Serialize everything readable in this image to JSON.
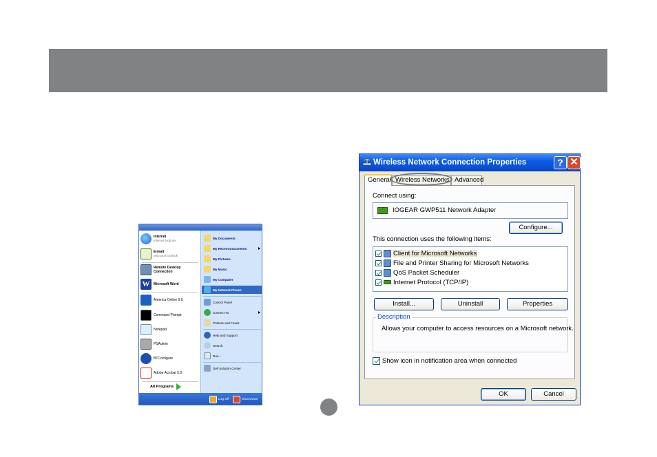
{
  "start_menu": {
    "pinned": [
      {
        "title": "Internet",
        "subtitle": "Internet Explorer",
        "icon": "internet-explorer-icon"
      },
      {
        "title": "E-mail",
        "subtitle": "Microsoft Outlook",
        "icon": "outlook-icon"
      }
    ],
    "recent": [
      {
        "label": "Remote Desktop Connection",
        "icon": "remote-desktop-icon"
      },
      {
        "label": "Microsoft Word",
        "icon": "word-icon"
      },
      {
        "label": "America Online 9.0",
        "icon": "aol-icon"
      },
      {
        "label": "Command Prompt",
        "icon": "command-prompt-icon"
      },
      {
        "label": "Notepad",
        "icon": "notepad-icon"
      },
      {
        "label": "PSAdmin",
        "icon": "psadmin-icon"
      },
      {
        "label": "BTConfigure",
        "icon": "bluetooth-icon"
      },
      {
        "label": "Adobe Acrobat 5.0",
        "icon": "acrobat-icon"
      }
    ],
    "all_programs": "All Programs",
    "right": [
      {
        "label": "My Documents",
        "icon": "folder-icon",
        "bold": true
      },
      {
        "label": "My Recent Documents",
        "icon": "recent-docs-icon",
        "bold": true,
        "arrow": true
      },
      {
        "label": "My Pictures",
        "icon": "pictures-icon",
        "bold": true
      },
      {
        "label": "My Music",
        "icon": "music-icon",
        "bold": true
      },
      {
        "label": "My Computer",
        "icon": "computer-icon",
        "bold": true
      },
      {
        "label": "My Network Places",
        "icon": "network-places-icon",
        "bold": true,
        "highlight": true
      },
      {
        "label": "Control Panel",
        "icon": "control-panel-icon"
      },
      {
        "label": "Connect To",
        "icon": "connect-icon",
        "arrow": true
      },
      {
        "label": "Printers and Faxes",
        "icon": "printer-icon"
      },
      {
        "label": "Help and Support",
        "icon": "help-icon"
      },
      {
        "label": "Search",
        "icon": "search-icon"
      },
      {
        "label": "Run...",
        "icon": "run-icon"
      },
      {
        "label": "Dell Solution Center",
        "icon": "dell-icon"
      }
    ],
    "logoff": "Log Off",
    "shutdown": "Shut Down"
  },
  "dialog": {
    "title": "Wireless Network Connection Properties",
    "help": "?",
    "close": "✕",
    "tabs": [
      "General",
      "Wireless Networks",
      "Advanced"
    ],
    "active_tab": "General",
    "connect_using_label": "Connect using:",
    "adapter": "IOGEAR GWP511 Network Adapter",
    "configure_button": "Configure...",
    "items_label": "This connection uses the following items:",
    "items": [
      {
        "label": "Client for Microsoft Networks",
        "checked": true,
        "selected": true
      },
      {
        "label": "File and Printer Sharing for Microsoft Networks",
        "checked": true
      },
      {
        "label": "QoS Packet Scheduler",
        "checked": true
      },
      {
        "label": "Internet Protocol (TCP/IP)",
        "checked": true
      }
    ],
    "install_button": "Install...",
    "uninstall_button": "Uninstall",
    "properties_button": "Properties",
    "description_legend": "Description",
    "description_text": "Allows your computer to access resources on a Microsoft network.",
    "show_icon_label": "Show icon in notification area when connected",
    "ok_button": "OK",
    "cancel_button": "Cancel"
  },
  "colors": {
    "header_band": "#808283",
    "xp_title_blue": "#0a4fd4",
    "dialog_face": "#ece9d8",
    "start_highlight": "#316ac5"
  }
}
